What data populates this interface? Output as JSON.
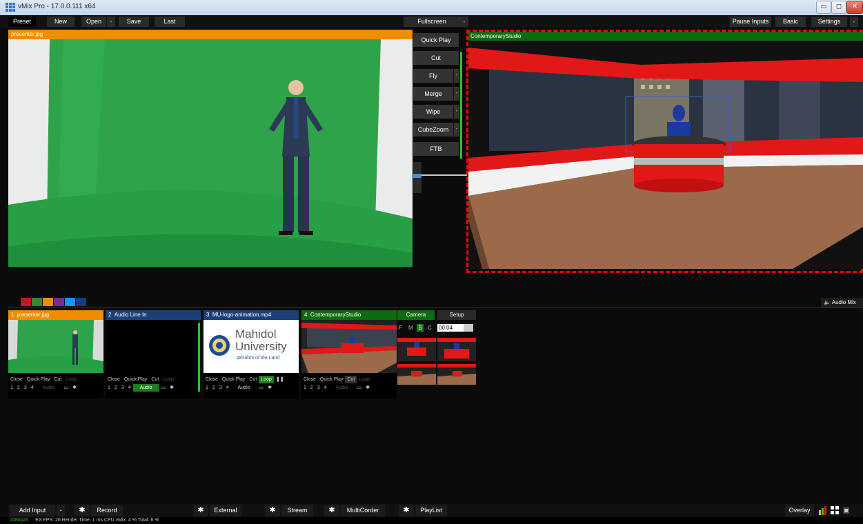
{
  "window": {
    "title": "vMix Pro - 17.0.0.111 x64",
    "minimize": "▭",
    "restore": "◻",
    "close": "✕"
  },
  "toolbar": {
    "preset": "Preset",
    "new": "New",
    "open": "Open",
    "save": "Save",
    "last": "Last",
    "fullscreen": "Fullscreen",
    "pause_inputs": "Pause Inputs",
    "basic": "Basic",
    "settings": "Settings",
    "dropdown_arrow": "-"
  },
  "preview": {
    "title": "presenter.jpg",
    "header_color": "#f08c00"
  },
  "program": {
    "title": "ContemporaryStudio",
    "header_color": "#0f6b0f"
  },
  "transitions": {
    "quick_play": "Quick Play",
    "cut": "Cut",
    "fly": "Fly",
    "merge": "Merge",
    "wipe": "Wipe",
    "cube_zoom": "CubeZoom",
    "ftb": "FTB",
    "arrow": "-"
  },
  "color_tags": [
    "#c8141e",
    "#2e8b2e",
    "#f08c00",
    "#7a2a9a",
    "#1e90ff",
    "#1a3a8a"
  ],
  "audio_mixer": {
    "icon": "speaker-icon",
    "label": "Audio Mix"
  },
  "inputs": [
    {
      "number": "1",
      "title": "presenter.jpg",
      "color": "#f08c00",
      "controls": [
        "Close",
        "Quick Play",
        "Cut",
        "Loop"
      ],
      "overlays": [
        "1",
        "2",
        "3",
        "4"
      ],
      "audio": "Audio"
    },
    {
      "number": "2",
      "title": "Audio Line In",
      "color": "#1c3f78",
      "controls": [
        "Close",
        "Quick Play",
        "Cut",
        "Loop"
      ],
      "overlays": [
        "1",
        "2",
        "3",
        "4"
      ],
      "audio": "Audio"
    },
    {
      "number": "3",
      "title": "MU-logo-animation.mp4",
      "color": "#1c3f78",
      "controls": [
        "Close",
        "Quick Play",
        "Cut",
        "Loop"
      ],
      "overlays": [
        "1",
        "2",
        "3",
        "4"
      ],
      "audio": "Audio",
      "logo_line1": "Mahidol",
      "logo_line2": "University",
      "logo_tagline": "Wisdom of the Land"
    },
    {
      "number": "4",
      "title": "ContemporaryStudio",
      "color": "#0f6b0f",
      "controls": [
        "Close",
        "Quick Play",
        "Cut",
        "Loop"
      ],
      "overlays": [
        "1",
        "2",
        "3",
        "4"
      ],
      "audio": "Audio"
    }
  ],
  "camera_panel": {
    "camera": "Camera",
    "setup": "Setup",
    "f": "F",
    "m": "M",
    "s": "S",
    "c": "C",
    "duration": "00:04"
  },
  "bottom": {
    "add_input": "Add Input",
    "arrow": "-",
    "record": "Record",
    "external": "External",
    "stream": "Stream",
    "multicorder": "MultiCorder",
    "playlist": "PlayList",
    "overlay": "Overlay"
  },
  "status": {
    "format": "1080p25",
    "ex": "EX",
    "fps_label": "FPS:",
    "fps": "26",
    "render_label": "Render Time:",
    "render": "1 ms",
    "cpu_label": "CPU vMix:",
    "cpu": "4 %",
    "total_label": "Total:",
    "total": "6 %"
  }
}
